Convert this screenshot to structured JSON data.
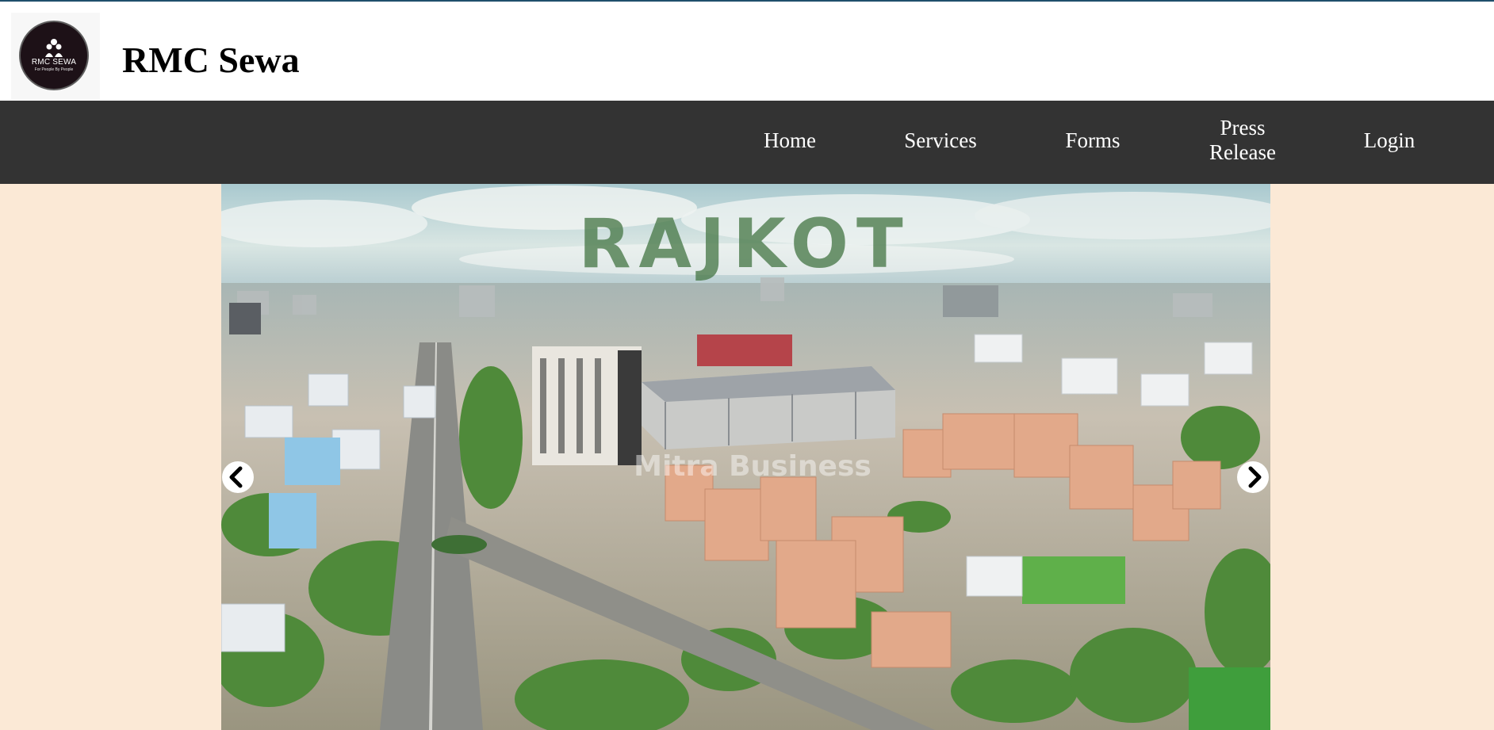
{
  "header": {
    "logo": {
      "text": "RMC SEWA",
      "tagline": "For People By People"
    },
    "title": "RMC Sewa"
  },
  "nav": {
    "items": [
      {
        "label": "Home"
      },
      {
        "label": "Services"
      },
      {
        "label": "Forms"
      },
      {
        "label": "Press Release"
      },
      {
        "label": "Login"
      }
    ]
  },
  "hero": {
    "image_overlay_text": "RAJKOT",
    "watermark": "Mitra Business"
  },
  "colors": {
    "nav_background": "#333333",
    "page_background": "#fbe9d6",
    "header_background": "#ffffff",
    "overlay_text": "#4a7a4a"
  },
  "icons": {
    "prev": "chevron-left-icon",
    "next": "chevron-right-icon"
  }
}
